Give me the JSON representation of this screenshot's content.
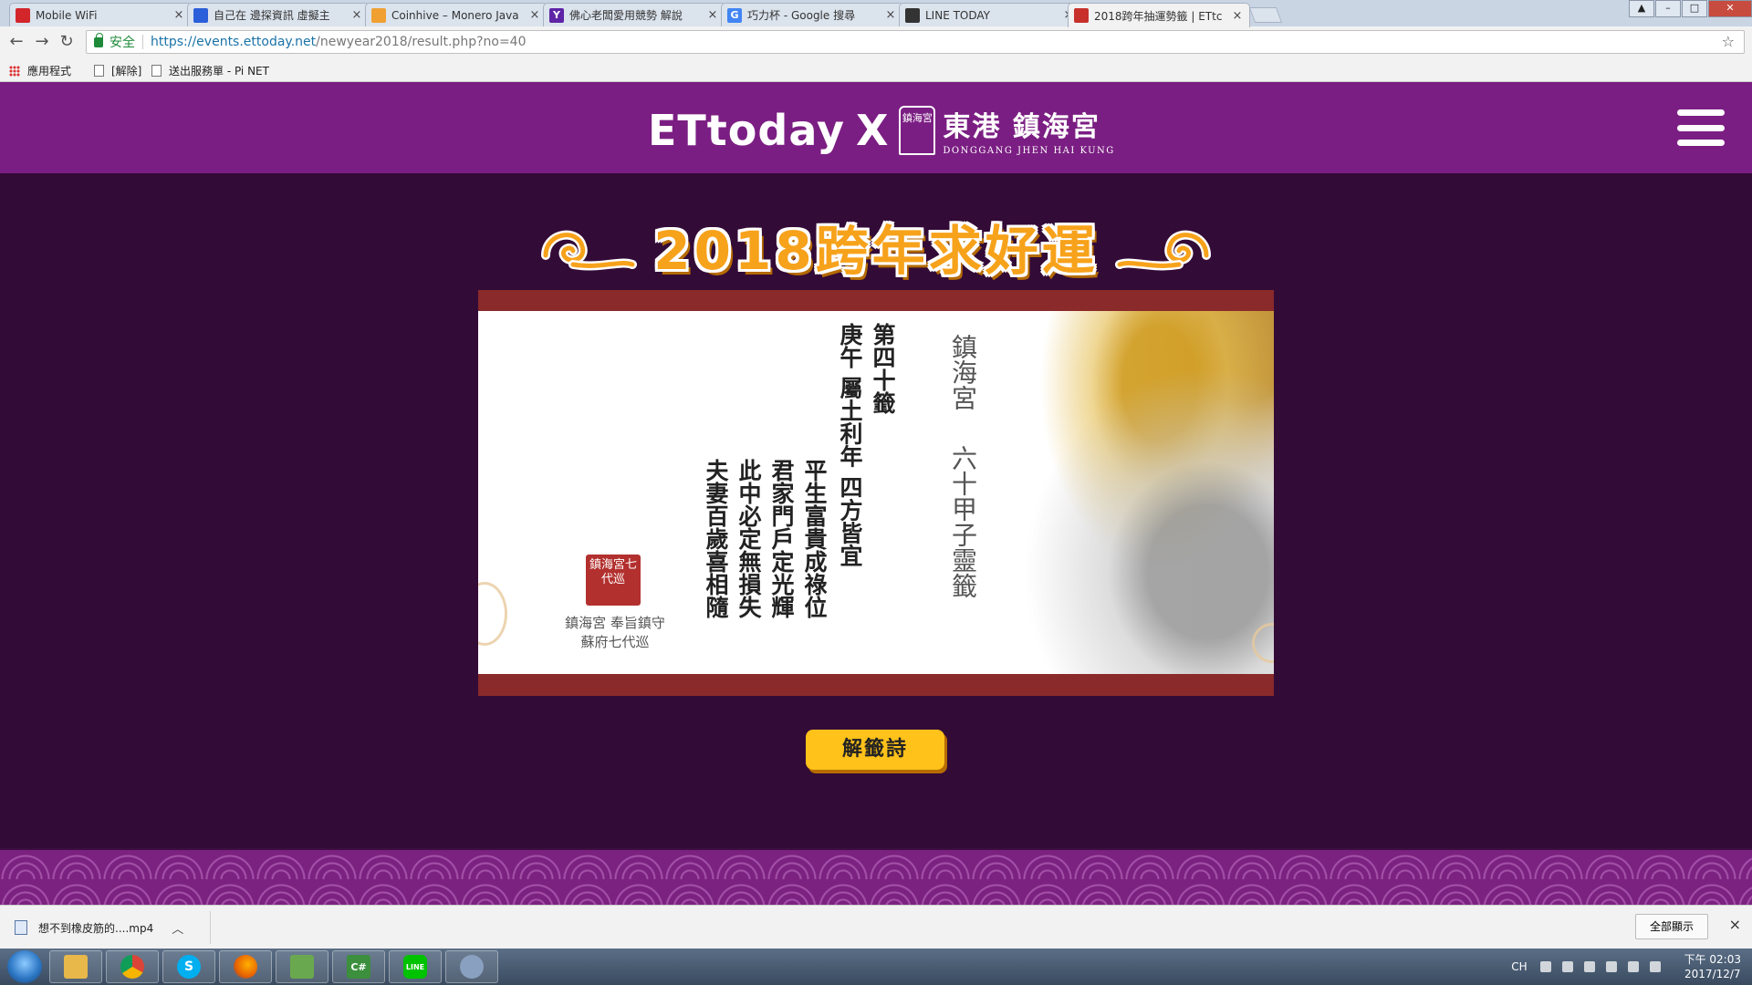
{
  "browser": {
    "tabs": [
      {
        "label": "Mobile WiFi",
        "favicon_color": "#d3262b",
        "active": false
      },
      {
        "label": "自己在 邊探資訊 虛擬主",
        "favicon_color": "#2b5fd9",
        "active": false
      },
      {
        "label": "Coinhive – Monero Java",
        "favicon_color": "#f0a030",
        "active": false
      },
      {
        "label": "佛心老闆愛用競勢 解說",
        "favicon_color": "#5f24a6",
        "active": false
      },
      {
        "label": "巧力杯 - Google 搜尋",
        "favicon_color": "#4285f4",
        "active": false
      },
      {
        "label": "LINE TODAY",
        "favicon_color": "#333333",
        "active": false
      },
      {
        "label": "2018跨年抽運勢籤 | ETtc",
        "favicon_color": "#c8312b",
        "active": true
      }
    ],
    "tab_close": "×",
    "secure_label": "安全",
    "url_host": "https://events.ettoday.net",
    "url_path": "/newyear2018/result.php?no=40",
    "bookmarks": [
      {
        "label": "應用程式"
      },
      {
        "label": "[解除]"
      },
      {
        "label": "送出服務單 - Pi NET"
      }
    ]
  },
  "site": {
    "logo_et": "ETtoday",
    "logo_x": "X",
    "logo_seal": "鎮海宮",
    "logo_cn": "東港 鎮海宮",
    "logo_sub": "DONGGANG JHEN HAI KUNG",
    "title": "2018跨年求好運",
    "button_label": "解籤詩"
  },
  "fortune": {
    "heading_col1": "第四十籤",
    "heading_col2": "庚午 屬土利年 四方皆宜",
    "lines": [
      "平生富貴成祿位",
      "君家門戶定光輝",
      "此中必定無損失",
      "夫妻百歲喜相隨"
    ],
    "calligraphy_col1": "鎮海宮",
    "calligraphy_col2": "六十甲子靈籤",
    "seal_text": "鎮海宮七代巡",
    "temple_note_1": "鎮海宮 奉旨鎮守",
    "temple_note_2": "蘇府七代巡"
  },
  "downloads": {
    "file_label": "想不到橡皮筋的....mp4",
    "show_all": "全部顯示",
    "close": "×"
  },
  "taskbar": {
    "apps": [
      {
        "name": "explorer",
        "glyph": "",
        "color": "#e8b84a"
      },
      {
        "name": "chrome",
        "glyph": "",
        "color": "#db4437"
      },
      {
        "name": "skype",
        "glyph": "S",
        "color": "#00aff0"
      },
      {
        "name": "firefox",
        "glyph": "",
        "color": "#e66000"
      },
      {
        "name": "notepad",
        "glyph": "",
        "color": "#6aa84f"
      },
      {
        "name": "csharp",
        "glyph": "C#",
        "color": "#3c8f3c"
      },
      {
        "name": "line",
        "glyph": "LINE",
        "color": "#00c300"
      },
      {
        "name": "paint",
        "glyph": "",
        "color": "#8aa0c0"
      }
    ],
    "lang": "CH",
    "time": "下午 02:03",
    "date": "2017/12/7"
  }
}
